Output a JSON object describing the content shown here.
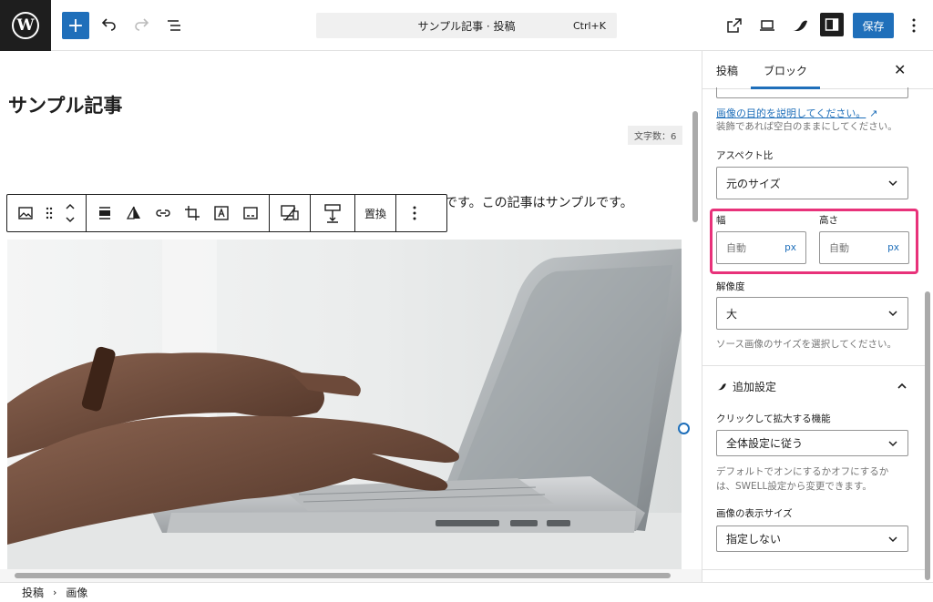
{
  "topbar": {
    "logo_glyph": "W",
    "add_label": "+",
    "command_title": "サンプル記事 · 投稿",
    "command_shortcut": "Ctrl+K",
    "save_label": "保存",
    "accent_color": "#1f6fba"
  },
  "editor": {
    "post_title": "サンプル記事",
    "word_count": "文字数：6",
    "paragraph_text": "です。この記事はサンプルです。",
    "toolbar_replace": "置換",
    "image_alt": "laptop-typing-photo"
  },
  "breadcrumb": {
    "items": [
      "投稿",
      "画像"
    ]
  },
  "sidebar": {
    "tabs": [
      "投稿",
      "ブロック"
    ],
    "alt_link": "画像の目的を説明してください。",
    "alt_help": "装飾であれば空白のままにしてください。",
    "aspect_label": "アスペクト比",
    "aspect_value": "元のサイズ",
    "width_label": "幅",
    "width_placeholder": "自動",
    "height_label": "高さ",
    "height_placeholder": "自動",
    "unit": "px",
    "resolution_label": "解像度",
    "resolution_value": "大",
    "resolution_help": "ソース画像のサイズを選択してください。",
    "extra_title": "追加設定",
    "lightbox_label": "クリックして拡大する機能",
    "lightbox_value": "全体設定に従う",
    "lightbox_help_1": "デフォルトでオンにするかオフにするか",
    "lightbox_help_2": "は、SWELL設定から変更できます。",
    "display_size_label": "画像の表示サイズ",
    "display_size_value": "指定しない",
    "highlight_color": "#e8327a"
  }
}
